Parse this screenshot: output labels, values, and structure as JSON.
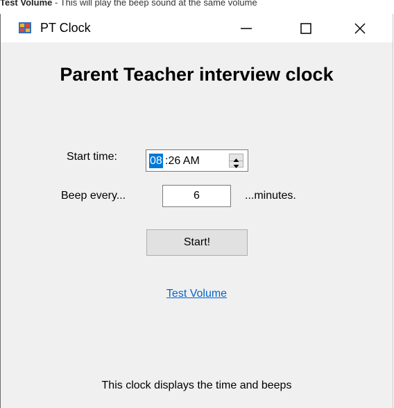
{
  "doc_context": {
    "bold_label": "Test Volume",
    "text": " - This will play the beep sound at the same volume"
  },
  "window": {
    "title": "PT Clock",
    "app_icon": "pt-clock-app-icon",
    "controls": [
      "minimize-icon",
      "maximize-icon",
      "close-icon"
    ]
  },
  "form": {
    "heading": "Parent Teacher interview clock",
    "start_time_label": "Start time:",
    "start_time_hour": "08",
    "start_time_rest": ":26 AM",
    "beep_label": "Beep every...",
    "beep_minutes": "6",
    "minutes_suffix": "...minutes.",
    "start_button": "Start!",
    "test_volume_link": "Test Volume",
    "footer": "This clock displays the time and beeps"
  },
  "colors": {
    "selection": "#0078d7",
    "link": "#0066cc",
    "window_bg": "#f0f0f0"
  }
}
